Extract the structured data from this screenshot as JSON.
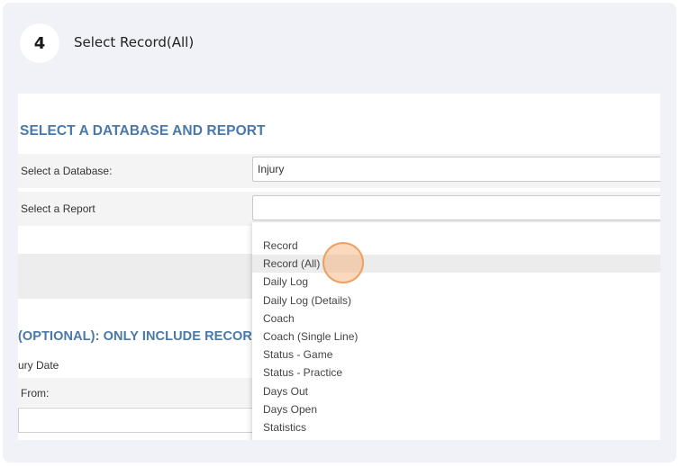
{
  "step": {
    "number": "4",
    "title": "Select Record(All)"
  },
  "form": {
    "section_title": "SELECT A DATABASE AND REPORT",
    "database_label": "Select a Database:",
    "database_value": "Injury",
    "report_label": "Select a Report",
    "report_value": "",
    "optional_title": "(OPTIONAL): ONLY INCLUDE RECORDS",
    "date_label": "ury Date",
    "from_label": "From:"
  },
  "dropdown": {
    "items": [
      "Record",
      "Record (All)",
      "Daily Log",
      "Daily Log (Details)",
      "Coach",
      "Coach (Single Line)",
      "Status - Game",
      "Status - Practice",
      "Days Out",
      "Days Open",
      "Statistics"
    ],
    "highlighted": "Record (All)"
  },
  "colors": {
    "accent": "#4a78a8",
    "cursor": "#f0a060",
    "card_bg": "#f0f2f7"
  }
}
